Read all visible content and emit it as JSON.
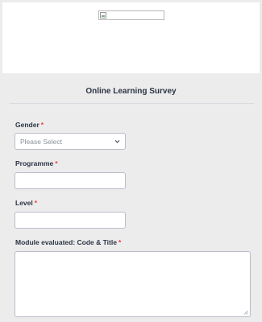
{
  "header": {
    "logo_icon": "broken-image-icon"
  },
  "form": {
    "title": "Online Learning Survey",
    "required_mark": "*",
    "gender": {
      "label": "Gender",
      "placeholder": "Please Select"
    },
    "programme": {
      "label": "Programme",
      "value": ""
    },
    "level": {
      "label": "Level",
      "value": ""
    },
    "module": {
      "label": "Module evaluated: Code & Title",
      "value": ""
    }
  },
  "colors": {
    "background": "#ececec",
    "required": "#f23a3c",
    "text": "#2c3345",
    "input_border": "#b8bdc9"
  }
}
